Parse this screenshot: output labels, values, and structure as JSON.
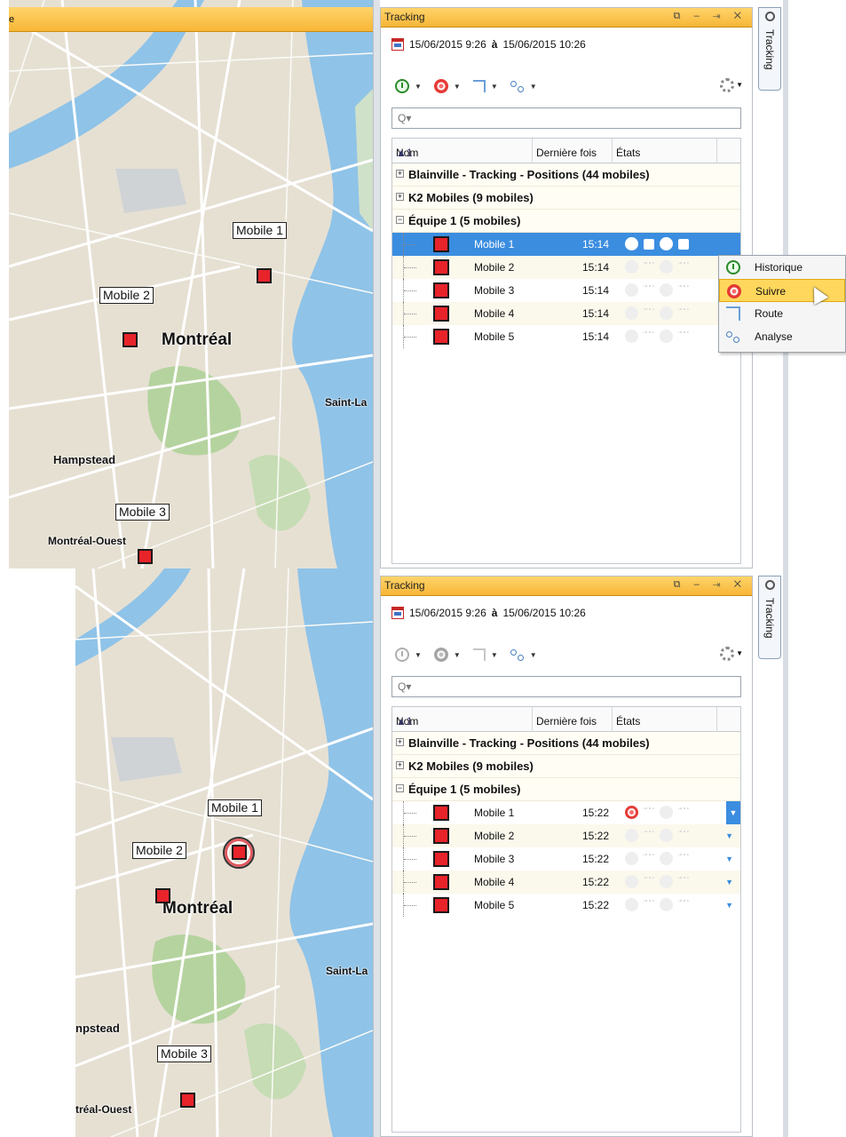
{
  "map": {
    "top_bar_text": "e",
    "city_labels": [
      "Montréal",
      "Saint-La",
      "Hampstead",
      "Montréal-Ouest"
    ],
    "city_labels_cropped": [
      "Montréal",
      "Saint-La",
      "npstead",
      "tréal-Ouest"
    ],
    "mobiles": [
      "Mobile 1",
      "Mobile 2",
      "Mobile 3"
    ]
  },
  "panel": {
    "title": "Tracking",
    "window_buttons": "⧉ – ⇥ ✕",
    "date_from": "15/06/2015  9:26",
    "date_sep": "à",
    "date_to": "15/06/2015  10:26",
    "search_placeholder": "Q▾",
    "columns": {
      "sort_indicator": "▲1",
      "name": "Nom",
      "last_time": "Dernière fois",
      "states": "États"
    },
    "groups": [
      {
        "label": "Blainville - Tracking - Positions (44 mobiles)",
        "expanded": false
      },
      {
        "label": "K2 Mobiles (9 mobiles)",
        "expanded": false
      },
      {
        "label": "Équipe 1 (5 mobiles)",
        "expanded": true
      }
    ]
  },
  "before": {
    "rows": [
      {
        "name": "Mobile 1",
        "time": "15:14",
        "selected": true
      },
      {
        "name": "Mobile 2",
        "time": "15:14"
      },
      {
        "name": "Mobile 3",
        "time": "15:14"
      },
      {
        "name": "Mobile 4",
        "time": "15:14"
      },
      {
        "name": "Mobile 5",
        "time": "15:14"
      }
    ]
  },
  "after": {
    "rows": [
      {
        "name": "Mobile 1",
        "time": "15:22",
        "following": true
      },
      {
        "name": "Mobile 2",
        "time": "15:22"
      },
      {
        "name": "Mobile 3",
        "time": "15:22"
      },
      {
        "name": "Mobile 4",
        "time": "15:22"
      },
      {
        "name": "Mobile 5",
        "time": "15:22"
      }
    ]
  },
  "context_menu": {
    "items": [
      "Historique",
      "Suivre",
      "Route",
      "Analyse"
    ],
    "highlighted": "Suivre"
  },
  "side_tab": {
    "label": "Tracking"
  },
  "colors": {
    "accent": "#f7b637",
    "selection": "#3b8de0",
    "marker": "#e8232a"
  }
}
